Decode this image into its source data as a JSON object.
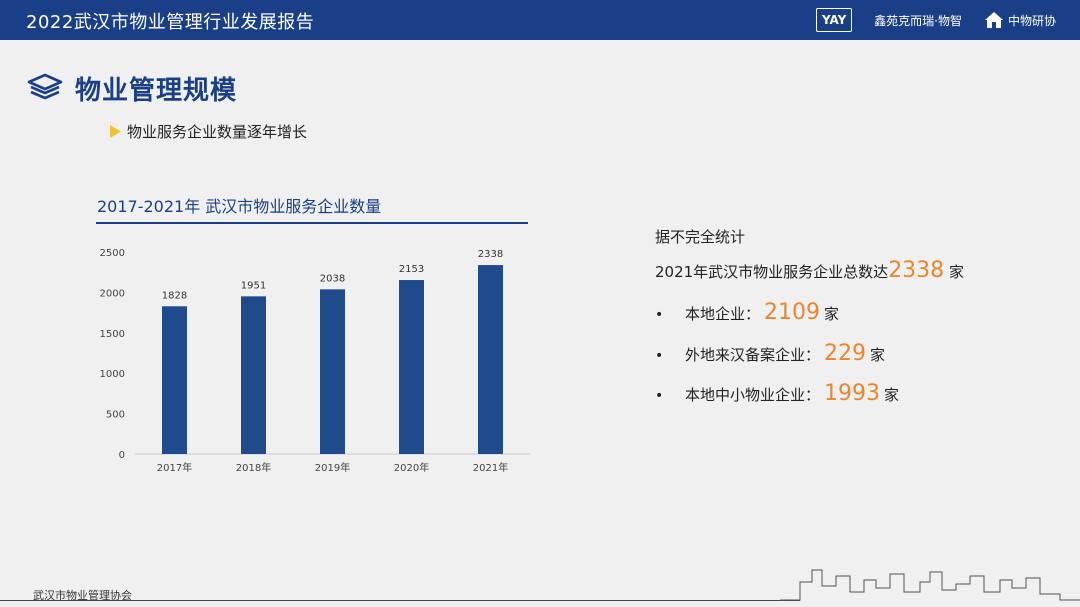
{
  "header": {
    "title": "2022武汉市物业管理行业发展报告",
    "logos": [
      "YAY",
      "鑫苑克而瑞·物智",
      "中物研协"
    ]
  },
  "section": {
    "title": "物业管理规模",
    "subtitle": "物业服务企业数量逐年增长"
  },
  "colors": {
    "brand": "#1a3f86",
    "bar": "#1f4a8c",
    "accent": "#e8862b",
    "bullet_triangle": "#f2c12e"
  },
  "chart_data": {
    "type": "bar",
    "title": "2017-2021年 武汉市物业服务企业数量",
    "categories": [
      "2017年",
      "2018年",
      "2019年",
      "2020年",
      "2021年"
    ],
    "values": [
      1828,
      1951,
      2038,
      2153,
      2338
    ],
    "ylim": [
      0,
      2500
    ],
    "yticks": [
      0,
      500,
      1000,
      1500,
      2000,
      2500
    ],
    "xlabel": "",
    "ylabel": "",
    "grid": false,
    "data_labels": true
  },
  "stats": {
    "heading": "据不完全统计",
    "total_prefix": "2021年武汉市物业服务企业总数达",
    "total_value": "2338",
    "total_unit": "家",
    "bullet_symbol": "•",
    "items": [
      {
        "label": "本地企业：",
        "value": "2109",
        "unit": "家"
      },
      {
        "label": "外地来汉备案企业：",
        "value": "229",
        "unit": "家"
      },
      {
        "label": "本地中小物业企业：",
        "value": "1993",
        "unit": "家"
      }
    ]
  },
  "footer": {
    "org": "武汉市物业管理协会"
  }
}
